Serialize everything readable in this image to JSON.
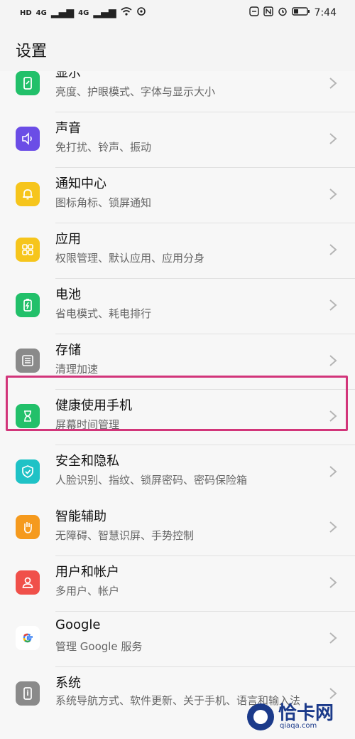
{
  "status_bar": {
    "left_items": [
      "HD",
      "4G",
      "4G",
      "wifi",
      "sync"
    ],
    "time": "7:44"
  },
  "header": {
    "title": "设置"
  },
  "settings_items": [
    {
      "title": "显示",
      "subtitle": "亮度、护眼模式、字体与显示大小",
      "icon": "display-icon",
      "color": "#22c06a"
    },
    {
      "title": "声音",
      "subtitle": "免打扰、铃声、振动",
      "icon": "sound-icon",
      "color": "#6b4de6"
    },
    {
      "title": "通知中心",
      "subtitle": "图标角标、锁屏通知",
      "icon": "bell-icon",
      "color": "#f6c51c"
    },
    {
      "title": "应用",
      "subtitle": "权限管理、默认应用、应用分身",
      "icon": "apps-icon",
      "color": "#f6c51c"
    },
    {
      "title": "电池",
      "subtitle": "省电模式、耗电排行",
      "icon": "battery-icon",
      "color": "#22c06a"
    },
    {
      "title": "存储",
      "subtitle": "清理加速",
      "icon": "storage-icon",
      "color": "#8a8a8a"
    },
    {
      "title": "健康使用手机",
      "subtitle": "屏幕时间管理",
      "icon": "hourglass-icon",
      "color": "#22c06a"
    },
    {
      "title": "安全和隐私",
      "subtitle": "人脸识别、指纹、锁屏密码、密码保险箱",
      "icon": "shield-icon",
      "color": "#1fc2c6"
    },
    {
      "title": "智能辅助",
      "subtitle": "无障碍、智慧识屏、手势控制",
      "icon": "hand-icon",
      "color": "#f59a1e"
    },
    {
      "title": "用户和帐户",
      "subtitle": "多用户、帐户",
      "icon": "user-icon",
      "color": "#f0504a"
    },
    {
      "title": "Google",
      "subtitle": "管理 Google 服务",
      "icon": "google-icon",
      "color": "#ffffff"
    },
    {
      "title": "系统",
      "subtitle": "系统导航方式、软件更新、关于手机、语言和输入法",
      "icon": "system-icon",
      "color": "#8a8a8a"
    }
  ],
  "watermark": {
    "main": "恰卡网",
    "sub": "qiaqa.com"
  }
}
